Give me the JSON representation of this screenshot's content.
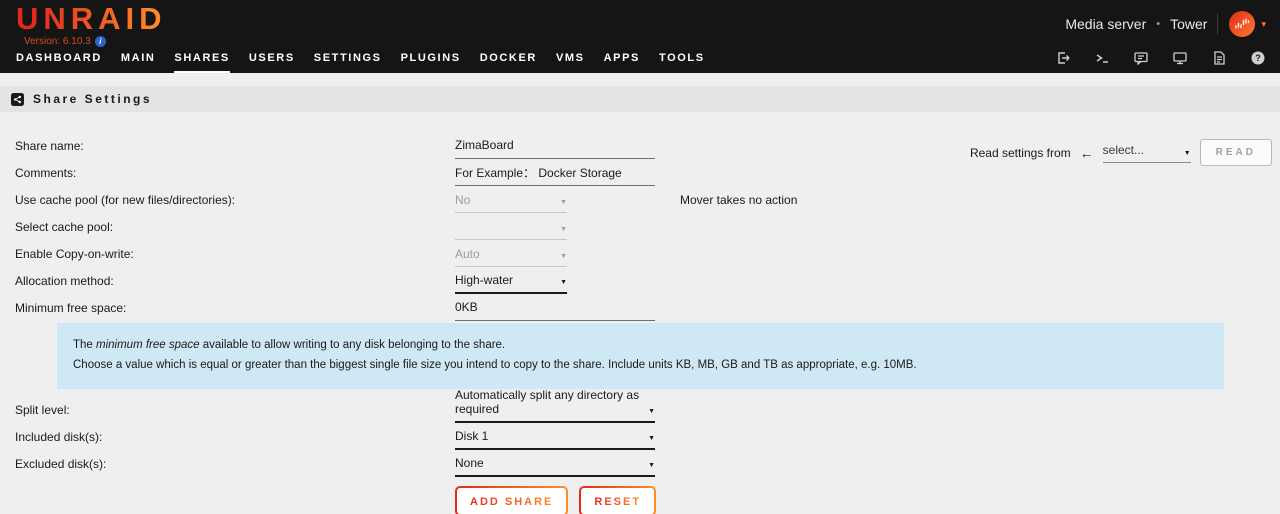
{
  "glyphs": {
    "caret_down": "▼",
    "arrow_left": "←",
    "bullet": "•",
    "avatar_caret": "▾",
    "info_i": "i"
  },
  "colors": {
    "accent_red": "#e02a1e",
    "accent_orange": "#ff8c2a",
    "header_bg": "#151515",
    "info_box_bg": "#cfe8f6",
    "section_bar_bg": "#e4e4e4"
  },
  "header": {
    "logo": "UNRAID",
    "version_label": "Version: 6.10.3",
    "server_label": "Media server",
    "server_name": "Tower",
    "nav": [
      {
        "label": "DASHBOARD"
      },
      {
        "label": "MAIN"
      },
      {
        "label": "SHARES"
      },
      {
        "label": "USERS"
      },
      {
        "label": "SETTINGS"
      },
      {
        "label": "PLUGINS"
      },
      {
        "label": "DOCKER"
      },
      {
        "label": "VMS"
      },
      {
        "label": "APPS"
      },
      {
        "label": "TOOLS"
      }
    ],
    "active_nav": "SHARES",
    "toolbar_icons": [
      "logout-icon",
      "terminal-icon",
      "feedback-icon",
      "display-icon",
      "log-icon",
      "help-icon"
    ]
  },
  "section": {
    "title": "Share Settings"
  },
  "read_settings": {
    "label": "Read settings from",
    "select_value": "select...",
    "button": "READ"
  },
  "form": {
    "rows": [
      {
        "label": "Share name:",
        "value": "ZimaBoard"
      },
      {
        "label": "Comments:",
        "value": "For Example： Docker Storage"
      },
      {
        "label": "Use cache pool (for new files/directories):",
        "value": "No",
        "note": "Mover takes no action"
      },
      {
        "label": "Select cache pool:",
        "value": ""
      },
      {
        "label": "Enable Copy-on-write:",
        "value": "Auto"
      },
      {
        "label": "Allocation method:",
        "value": "High-water"
      },
      {
        "label": "Minimum free space:",
        "value": "0KB"
      }
    ],
    "info_box": {
      "line1_pre": "The ",
      "line1_italic": "minimum free space",
      "line1_post": " available to allow writing to any disk belonging to the share.",
      "line2": "Choose a value which is equal or greater than the biggest single file size you intend to copy to the share. Include units KB, MB, GB and TB as appropriate, e.g. 10MB."
    },
    "bottom_rows": [
      {
        "label": "Split level:",
        "value": "Automatically split any directory as required"
      },
      {
        "label": "Included disk(s):",
        "value": "Disk 1"
      },
      {
        "label": "Excluded disk(s):",
        "value": "None"
      }
    ],
    "buttons": {
      "add_share": "ADD SHARE",
      "reset": "RESET"
    }
  }
}
